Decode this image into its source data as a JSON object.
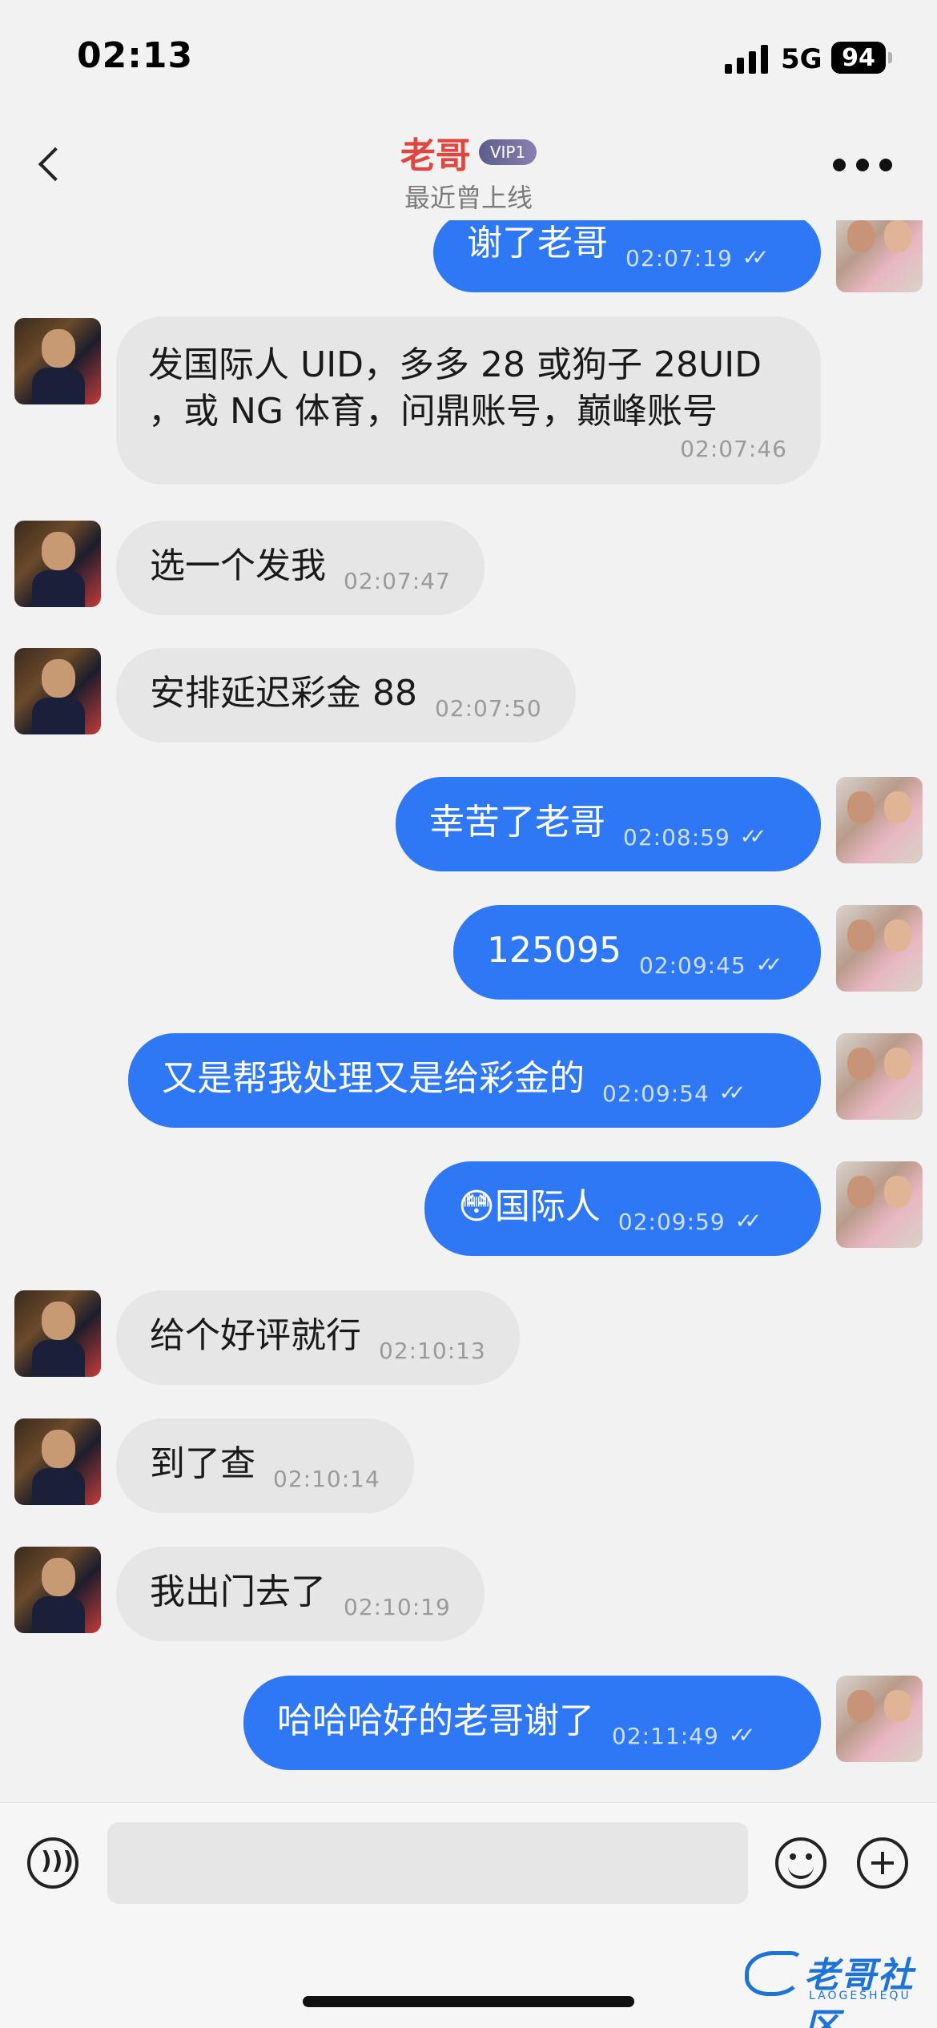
{
  "status_bar": {
    "time": "02:13",
    "network": "5G",
    "battery": "94"
  },
  "header": {
    "title": "老哥",
    "badge": "VIP1",
    "subtitle": "最近曾上线"
  },
  "messages": [
    {
      "side": "out",
      "text": "谢了老哥",
      "time": "02:07:19",
      "read": true
    },
    {
      "side": "in",
      "text": "发国际人 UID，多多 28 或狗子 28UID ，或 NG 体育，问鼎账号，巅峰账号",
      "time": "02:07:46"
    },
    {
      "side": "in",
      "text": "选一个发我",
      "time": "02:07:47"
    },
    {
      "side": "in",
      "text": "安排延迟彩金 88",
      "time": "02:07:50"
    },
    {
      "side": "out",
      "text": "幸苦了老哥",
      "time": "02:08:59",
      "read": true
    },
    {
      "side": "out",
      "text": "125095",
      "time": "02:09:45",
      "read": true
    },
    {
      "side": "out",
      "text": "又是帮我处理又是给彩金的",
      "time": "02:09:54",
      "read": true
    },
    {
      "side": "out",
      "text": "😳国际人",
      "time": "02:09:59",
      "read": true
    },
    {
      "side": "in",
      "text": "给个好评就行",
      "time": "02:10:13"
    },
    {
      "side": "in",
      "text": "到了查",
      "time": "02:10:14"
    },
    {
      "side": "in",
      "text": "我出门去了",
      "time": "02:10:19"
    },
    {
      "side": "out",
      "text": "哈哈哈好的老哥谢了",
      "time": "02:11:49",
      "read": true
    }
  ],
  "input_bar": {
    "voice_icon": "voice-icon",
    "emoji_icon": "emoji-icon",
    "add_icon": "plus-icon"
  },
  "watermark": {
    "text": "老哥社区",
    "sub": "LAOGESHEQU"
  },
  "colors": {
    "outgoing_bubble": "#2f78f5",
    "incoming_bubble": "#e6e6e6",
    "title": "#e2453f"
  }
}
